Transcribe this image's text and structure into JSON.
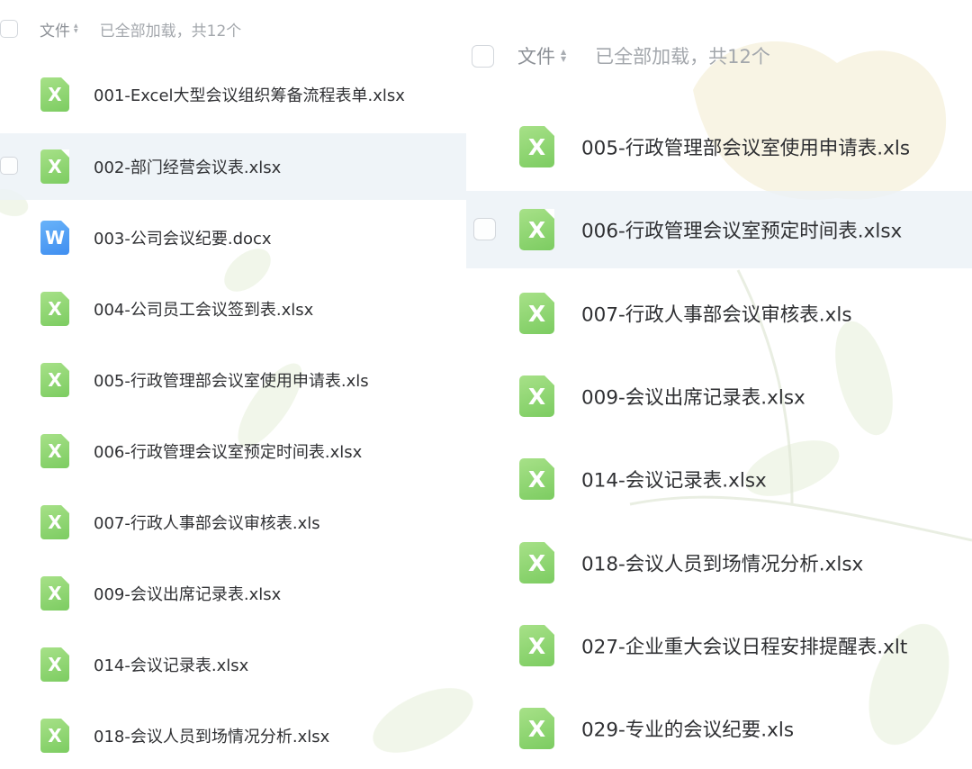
{
  "left": {
    "header": {
      "column_label": "文件",
      "sort_icon": "sort-icon",
      "load_status": "已全部加载，共12个"
    },
    "files": [
      {
        "name": "001-Excel大型会议组织筹备流程表单.xlsx",
        "type": "excel",
        "icon_glyph": "X"
      },
      {
        "name": "002-部门经营会议表.xlsx",
        "type": "excel",
        "icon_glyph": "X"
      },
      {
        "name": "003-公司会议纪要.docx",
        "type": "word",
        "icon_glyph": "W"
      },
      {
        "name": "004-公司员工会议签到表.xlsx",
        "type": "excel",
        "icon_glyph": "X"
      },
      {
        "name": "005-行政管理部会议室使用申请表.xls",
        "type": "excel",
        "icon_glyph": "X"
      },
      {
        "name": "006-行政管理会议室预定时间表.xlsx",
        "type": "excel",
        "icon_glyph": "X"
      },
      {
        "name": "007-行政人事部会议审核表.xls",
        "type": "excel",
        "icon_glyph": "X"
      },
      {
        "name": "009-会议出席记录表.xlsx",
        "type": "excel",
        "icon_glyph": "X"
      },
      {
        "name": "014-会议记录表.xlsx",
        "type": "excel",
        "icon_glyph": "X"
      },
      {
        "name": "018-会议人员到场情况分析.xlsx",
        "type": "excel",
        "icon_glyph": "X"
      }
    ]
  },
  "right": {
    "header": {
      "column_label": "文件",
      "sort_icon": "sort-icon",
      "load_status": "已全部加载，共12个"
    },
    "files": [
      {
        "name": "005-行政管理部会议室使用申请表.xls",
        "type": "excel",
        "icon_glyph": "X"
      },
      {
        "name": "006-行政管理会议室预定时间表.xlsx",
        "type": "excel",
        "icon_glyph": "X"
      },
      {
        "name": "007-行政人事部会议审核表.xls",
        "type": "excel",
        "icon_glyph": "X"
      },
      {
        "name": "009-会议出席记录表.xlsx",
        "type": "excel",
        "icon_glyph": "X"
      },
      {
        "name": "014-会议记录表.xlsx",
        "type": "excel",
        "icon_glyph": "X"
      },
      {
        "name": "018-会议人员到场情况分析.xlsx",
        "type": "excel",
        "icon_glyph": "X"
      },
      {
        "name": "027-企业重大会议日程安排提醒表.xlt",
        "type": "excel",
        "icon_glyph": "X"
      },
      {
        "name": "029-专业的会议纪要.xls",
        "type": "excel",
        "icon_glyph": "X"
      }
    ]
  },
  "colors": {
    "excel_icon": "#8fd672",
    "word_icon": "#4f9cf5",
    "row_hover": "#edf2f7",
    "header_text": "#8c9096",
    "file_text": "#2f3033"
  }
}
